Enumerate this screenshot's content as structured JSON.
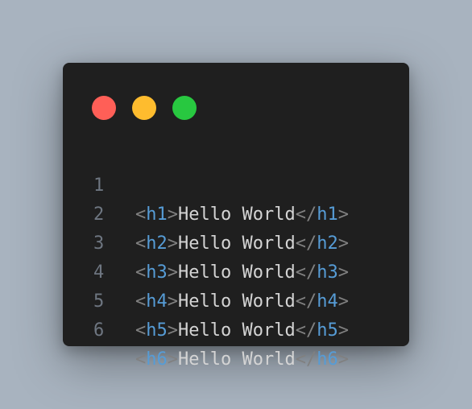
{
  "colors": {
    "background": "#a8b3bf",
    "window": "#1f1f1f",
    "dot_close": "#ff5f57",
    "dot_minimize": "#febc2e",
    "dot_zoom": "#28c840",
    "line_number": "#6e7681",
    "bracket": "#808080",
    "tag": "#569cd6",
    "text": "#d4d4d4"
  },
  "window_controls": [
    "close",
    "minimize",
    "zoom"
  ],
  "code_lines": [
    {
      "number": "1",
      "open_bracket": "<",
      "open_tag": "h1",
      "close_bracket": ">",
      "content": "Hello World",
      "end_open": "</",
      "end_tag": "h1",
      "end_close": ">"
    },
    {
      "number": "2",
      "open_bracket": "<",
      "open_tag": "h2",
      "close_bracket": ">",
      "content": "Hello World",
      "end_open": "</",
      "end_tag": "h2",
      "end_close": ">"
    },
    {
      "number": "3",
      "open_bracket": "<",
      "open_tag": "h3",
      "close_bracket": ">",
      "content": "Hello World",
      "end_open": "</",
      "end_tag": "h3",
      "end_close": ">"
    },
    {
      "number": "4",
      "open_bracket": "<",
      "open_tag": "h4",
      "close_bracket": ">",
      "content": "Hello World",
      "end_open": "</",
      "end_tag": "h4",
      "end_close": ">"
    },
    {
      "number": "5",
      "open_bracket": "<",
      "open_tag": "h5",
      "close_bracket": ">",
      "content": "Hello World",
      "end_open": "</",
      "end_tag": "h5",
      "end_close": ">"
    },
    {
      "number": "6",
      "open_bracket": "<",
      "open_tag": "h6",
      "close_bracket": ">",
      "content": "Hello World",
      "end_open": "</",
      "end_tag": "h6",
      "end_close": ">"
    }
  ]
}
